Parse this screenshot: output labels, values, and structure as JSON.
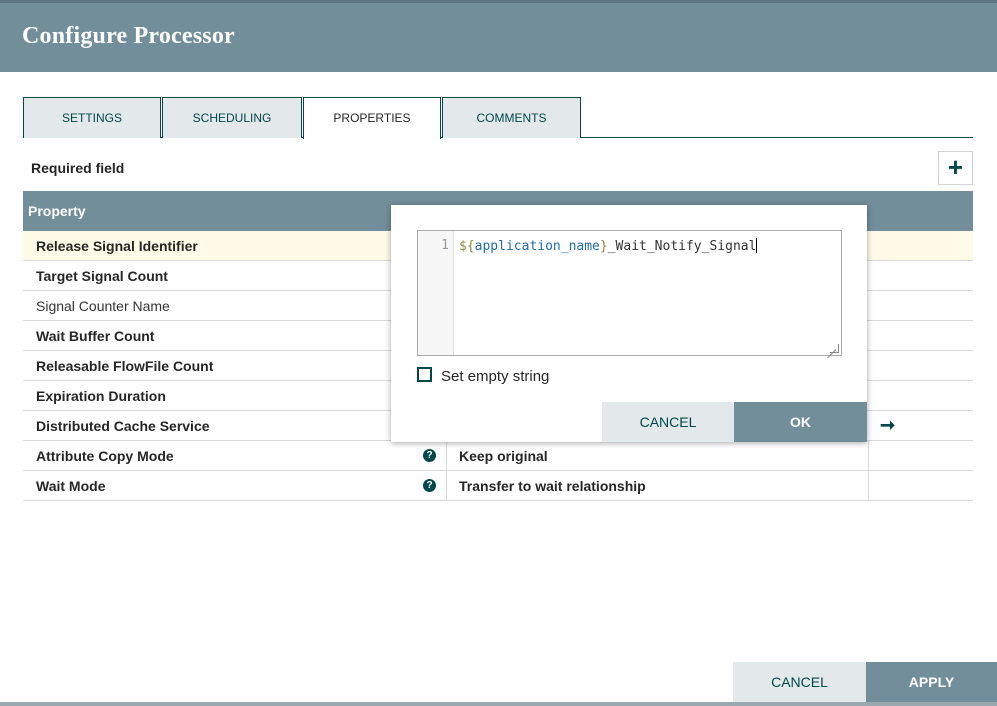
{
  "dialog": {
    "title": "Configure Processor"
  },
  "tabs": [
    {
      "label": "SETTINGS"
    },
    {
      "label": "SCHEDULING"
    },
    {
      "label": "PROPERTIES"
    },
    {
      "label": "COMMENTS"
    }
  ],
  "properties": {
    "required_label": "Required field",
    "add_icon": "+",
    "column_header": "Property",
    "rows": [
      {
        "name": "Release Signal Identifier",
        "value": ""
      },
      {
        "name": "Target Signal Count",
        "value": ""
      },
      {
        "name": "Signal Counter Name",
        "value": ""
      },
      {
        "name": "Wait Buffer Count",
        "value": ""
      },
      {
        "name": "Releasable FlowFile Count",
        "value": ""
      },
      {
        "name": "Expiration Duration",
        "value": ""
      },
      {
        "name": "Distributed Cache Service",
        "value": ""
      },
      {
        "name": "Attribute Copy Mode",
        "value": "Keep original"
      },
      {
        "name": "Wait Mode",
        "value": "Transfer to wait relationship"
      }
    ],
    "help_icon": "?",
    "arrow_icon": "➞"
  },
  "editor": {
    "line_number": "1",
    "code_dollar_open": "${",
    "code_var": "application_name",
    "code_close": "}",
    "code_rest": "_Wait_Notify_Signal",
    "set_empty_label": "Set empty string",
    "cancel_label": "CANCEL",
    "ok_label": "OK"
  },
  "footer": {
    "cancel_label": "CANCEL",
    "apply_label": "APPLY"
  },
  "colors": {
    "header": "#728e9b",
    "accent": "#004849",
    "selected_row": "#fffbe8"
  }
}
